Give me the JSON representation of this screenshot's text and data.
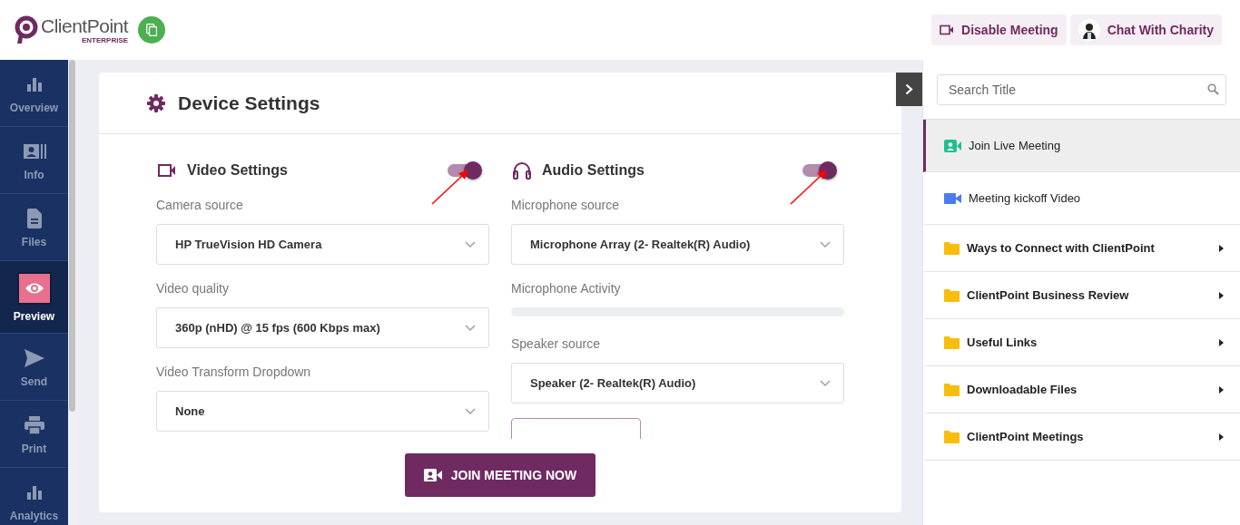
{
  "header": {
    "logo": {
      "name": "ClientPoint",
      "edition": "ENTERPRISE"
    },
    "buttons": [
      {
        "kind": "camera",
        "label": "Disable Meeting"
      },
      {
        "kind": "avatar",
        "label": "Chat With Charity"
      }
    ]
  },
  "nav": [
    {
      "kind": "bars",
      "label": "Overview",
      "selected": false
    },
    {
      "kind": "contact",
      "label": "Info",
      "selected": false
    },
    {
      "kind": "file",
      "label": "Files",
      "selected": false
    },
    {
      "kind": "eye",
      "label": "Preview",
      "selected": true
    },
    {
      "kind": "send",
      "label": "Send",
      "selected": false
    },
    {
      "kind": "print",
      "label": "Print",
      "selected": false
    },
    {
      "kind": "bars",
      "label": "Analytics",
      "selected": false
    }
  ],
  "card": {
    "title": "Device Settings",
    "sections": [
      {
        "kind": "video",
        "title": "Video Settings",
        "on": true,
        "fields": [
          {
            "kind": "select",
            "label": "Camera source",
            "value": "HP TrueVision HD Camera"
          },
          {
            "kind": "select",
            "label": "Video quality",
            "value": "360p (nHD) @ 15 fps (600 Kbps max)"
          },
          {
            "kind": "select",
            "label": "Video Transform Dropdown",
            "value": "None"
          }
        ]
      },
      {
        "kind": "audio",
        "title": "Audio Settings",
        "on": true,
        "fields": [
          {
            "kind": "select",
            "label": "Microphone source",
            "value": "Microphone Array (2- Realtek(R) Audio)"
          },
          {
            "kind": "meter",
            "label": "Microphone Activity",
            "level": 0
          },
          {
            "kind": "select",
            "label": "Speaker source",
            "value": "Speaker (2- Realtek(R) Audio)"
          },
          {
            "kind": "outline-button"
          }
        ]
      }
    ],
    "action": "JOIN MEETING NOW"
  },
  "panel": {
    "search": {
      "placeholder": "Search Title"
    },
    "items": [
      {
        "kind": "live",
        "label": "Join Live Meeting",
        "selected": true,
        "expandable": false
      },
      {
        "kind": "video",
        "label": "Meeting kickoff Video",
        "selected": false,
        "expandable": false
      },
      {
        "kind": "folder",
        "label": "Ways to Connect with ClientPoint",
        "selected": false,
        "expandable": true
      },
      {
        "kind": "folder",
        "label": "ClientPoint Business Review",
        "selected": false,
        "expandable": true
      },
      {
        "kind": "folder",
        "label": "Useful Links",
        "selected": false,
        "expandable": true
      },
      {
        "kind": "folder",
        "label": "Downloadable Files",
        "selected": false,
        "expandable": true
      },
      {
        "kind": "folder",
        "label": "ClientPoint Meetings",
        "selected": false,
        "expandable": true
      }
    ]
  }
}
